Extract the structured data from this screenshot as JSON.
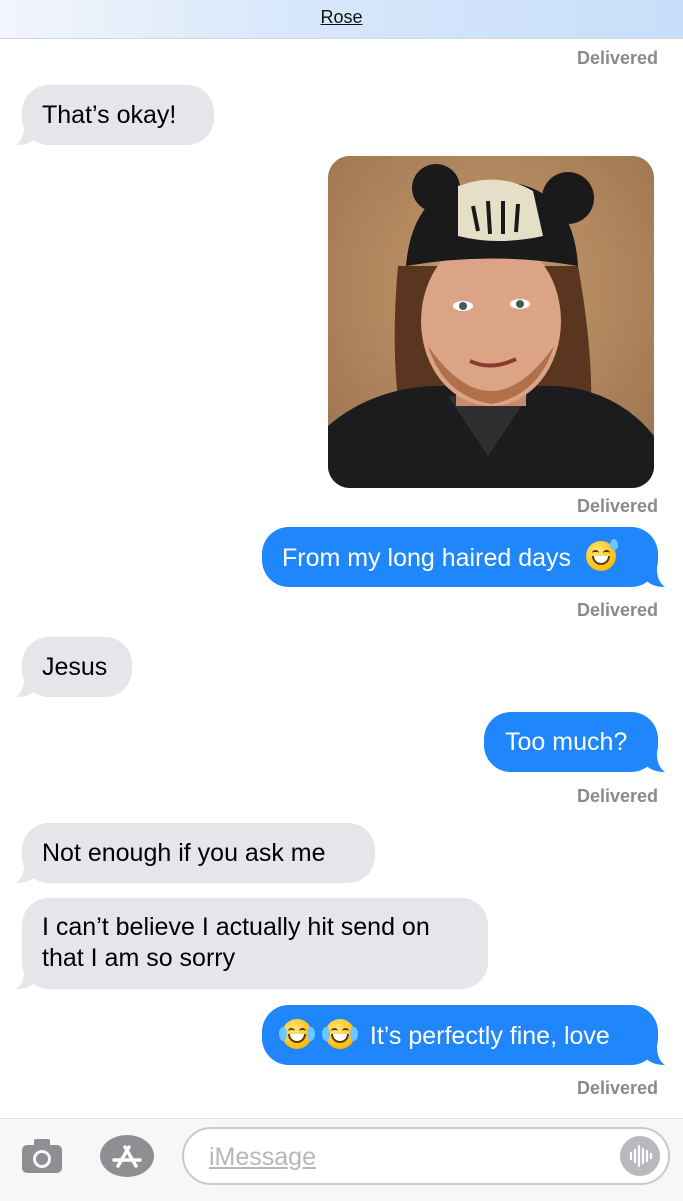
{
  "header": {
    "contact_name": "Rose"
  },
  "messages": [
    {
      "kind": "status",
      "text": "Delivered"
    },
    {
      "kind": "incoming",
      "text": "That’s okay!"
    },
    {
      "kind": "outgoing-image",
      "alt": "photo"
    },
    {
      "kind": "status",
      "text": "Delivered"
    },
    {
      "kind": "outgoing",
      "text": "From my long haired days",
      "emoji": "grinning-sweat-emoji"
    },
    {
      "kind": "status",
      "text": "Delivered"
    },
    {
      "kind": "incoming",
      "text": "Jesus"
    },
    {
      "kind": "outgoing",
      "text": "Too much?"
    },
    {
      "kind": "status",
      "text": "Delivered"
    },
    {
      "kind": "incoming",
      "text": "Not enough if you ask me"
    },
    {
      "kind": "incoming",
      "lines": [
        "I can’t believe I actually hit send on",
        "that I am so sorry"
      ]
    },
    {
      "kind": "outgoing",
      "text": "It’s perfectly fine, love",
      "emoji": "tears-of-joy-emoji"
    },
    {
      "kind": "status",
      "text": "Delivered"
    }
  ],
  "toolbar": {
    "camera_icon": "camera-icon",
    "apps_icon": "app-store-icon",
    "input_placeholder": "iMessage",
    "audio_icon": "audio-waveform-icon"
  },
  "colors": {
    "incoming_bubble": "#e5e5ea",
    "outgoing_bubble": "#1f86fb",
    "status_text": "#8a8a8e"
  }
}
